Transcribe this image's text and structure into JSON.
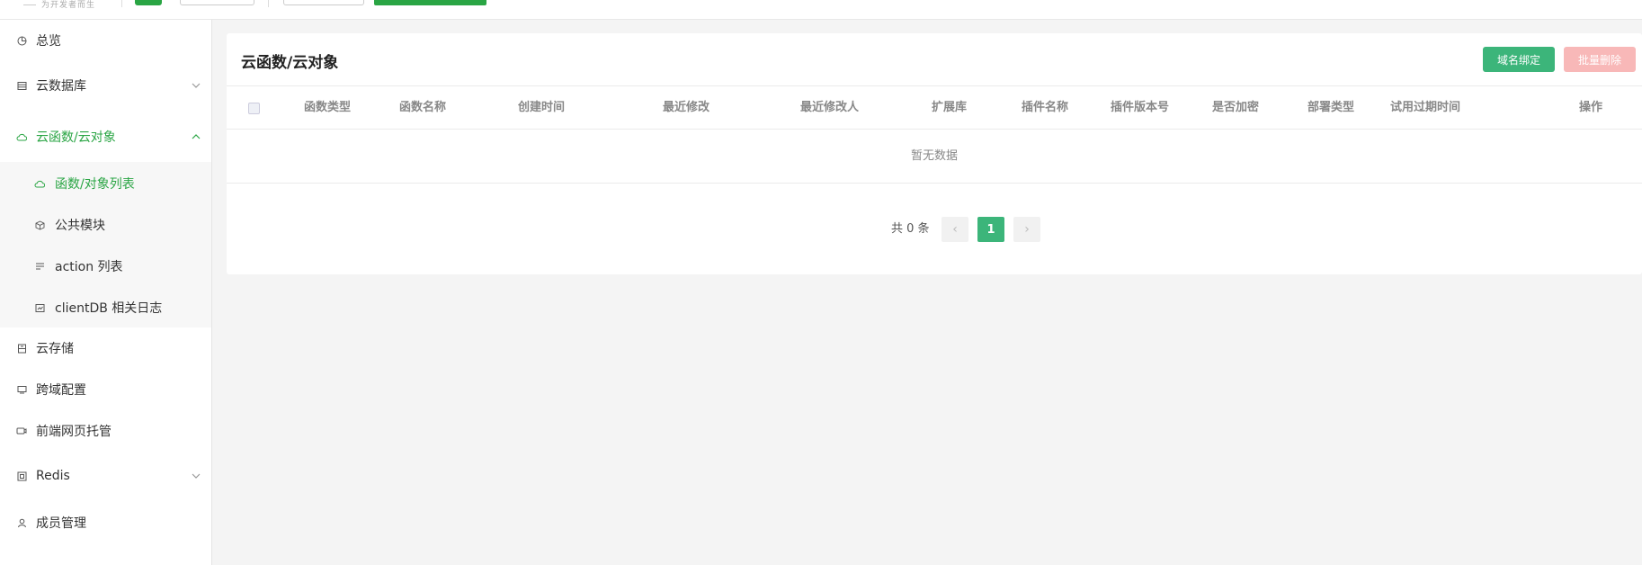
{
  "topbar": {
    "logo_subtitle": "为开发者而生"
  },
  "sidebar": {
    "items": [
      {
        "label": "总览",
        "icon": "pie-chart-icon"
      },
      {
        "label": "云数据库",
        "icon": "database-icon"
      },
      {
        "label": "云函数/云对象",
        "icon": "cloud-icon"
      },
      {
        "label": "云存储",
        "icon": "storage-icon"
      },
      {
        "label": "跨域配置",
        "icon": "monitor-icon"
      },
      {
        "label": "前端网页托管",
        "icon": "hosting-icon"
      },
      {
        "label": "Redis",
        "icon": "redis-icon"
      },
      {
        "label": "成员管理",
        "icon": "user-icon"
      }
    ],
    "subitems": [
      {
        "label": "函数/对象列表",
        "icon": "cloud-icon"
      },
      {
        "label": "公共模块",
        "icon": "cube-icon"
      },
      {
        "label": "action 列表",
        "icon": "list-icon"
      },
      {
        "label": "clientDB 相关日志",
        "icon": "log-icon"
      }
    ]
  },
  "panel": {
    "title": "云函数/云对象",
    "bind_domain_button": "域名绑定",
    "batch_delete_button": "批量删除",
    "columns": [
      "函数类型",
      "函数名称",
      "创建时间",
      "最近修改",
      "最近修改人",
      "扩展库",
      "插件名称",
      "插件版本号",
      "是否加密",
      "部署类型",
      "试用过期时间",
      "操作"
    ],
    "empty_text": "暂无数据",
    "pagination": {
      "total_text": "共 0 条",
      "current_page": "1",
      "prev": "‹",
      "next": "›"
    }
  },
  "colors": {
    "accent": "#2aa544",
    "button_green": "#3cb57a",
    "button_disabled_red": "#f8b8b8"
  }
}
